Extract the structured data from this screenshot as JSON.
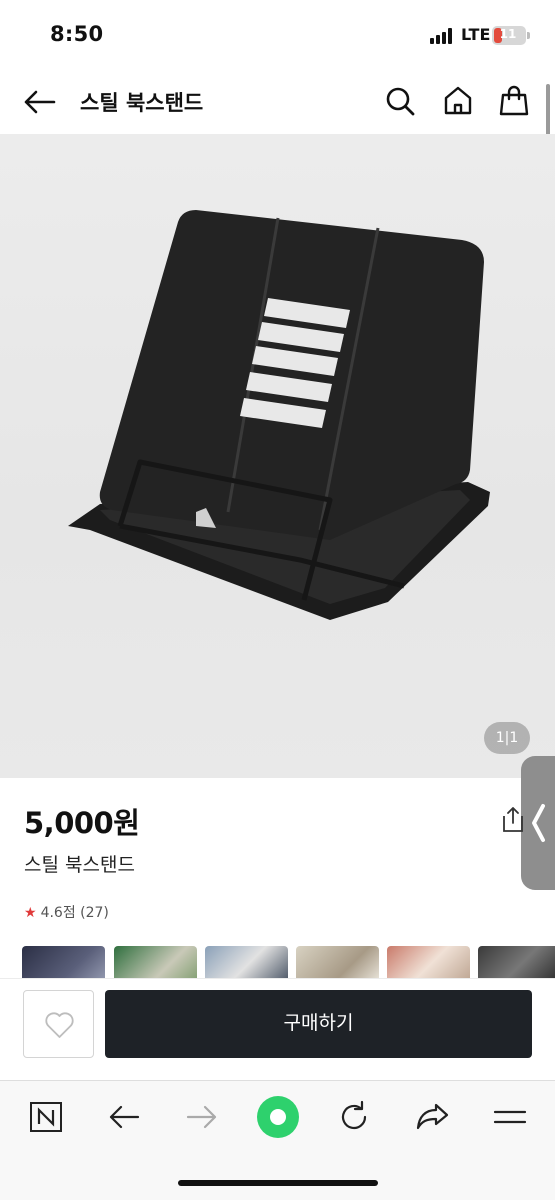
{
  "status_bar": {
    "time": "8:50",
    "network": "LTE",
    "battery": "11"
  },
  "header": {
    "title": "스틸 북스탠드",
    "icons": [
      "back-arrow-icon",
      "search-icon",
      "home-icon",
      "shopping-bag-icon"
    ]
  },
  "gallery": {
    "counter": "1|1",
    "image": "black steel book stand product photo"
  },
  "product": {
    "price": "5,000원",
    "name": "스틸 북스탠드",
    "rating": "4.6점 (27)"
  },
  "thumbnails": [
    "review-photo-1",
    "review-photo-2",
    "review-photo-3",
    "review-photo-4",
    "review-photo-5",
    "review-photo-6",
    "review-photo-7"
  ],
  "actions": {
    "buy_label": "구매하기"
  },
  "browser_toolbar": [
    "naver-n-icon",
    "back-icon",
    "forward-icon",
    "green-dot-icon",
    "refresh-icon",
    "share-icon",
    "menu-icon"
  ],
  "colors": {
    "buy_button": "#1e2227",
    "accent_green": "#2ed16d",
    "star": "#e03a3a"
  }
}
